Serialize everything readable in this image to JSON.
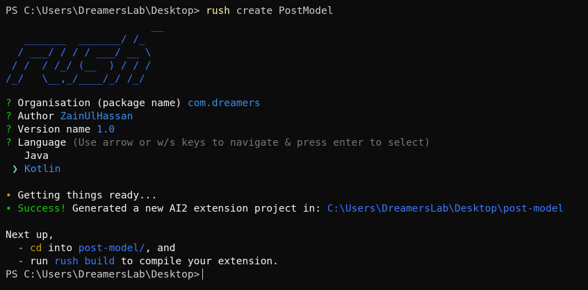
{
  "terminal": {
    "prompt": "PS C:\\Users\\DreamersLab\\Desktop>",
    "command": "rush",
    "command_args": "create PostModel",
    "ascii_logo": "                        __\n   _______  _______/ /_\n  / ___/ / / / ___/ __ \\\n / /  / /_/ (__  ) / / /\n/_/   \\__,_/____/_/ /_/",
    "questions": [
      {
        "mark": "?",
        "label": "Organisation (package name)",
        "answer": "com.dreamers"
      },
      {
        "mark": "?",
        "label": "Author",
        "answer": "ZainUlHassan"
      },
      {
        "mark": "?",
        "label": "Version name",
        "answer": "1.0"
      },
      {
        "mark": "?",
        "label": "Language",
        "hint": "(Use arrow or w/s keys to navigate & press enter to select)"
      }
    ],
    "options": [
      {
        "pointer": "",
        "label": "Java"
      },
      {
        "pointer": "❯",
        "label": "Kotlin"
      }
    ],
    "status": [
      {
        "bullet": "•",
        "text": "Getting things ready..."
      },
      {
        "bullet": "•",
        "success": "Success!",
        "text": "Generated a new AI2 extension project in:",
        "path": "C:\\Users\\DreamersLab\\Desktop\\post-model"
      }
    ],
    "next": {
      "heading": "Next up,",
      "step1_dash": "-",
      "step1_cmd": "cd",
      "step1_mid": "into",
      "step1_dir": "post-model/",
      "step1_end": ", and",
      "step2_dash": "-",
      "step2_pre": "run",
      "step2_cmd": "rush build",
      "step2_end": "to compile your extension."
    }
  }
}
